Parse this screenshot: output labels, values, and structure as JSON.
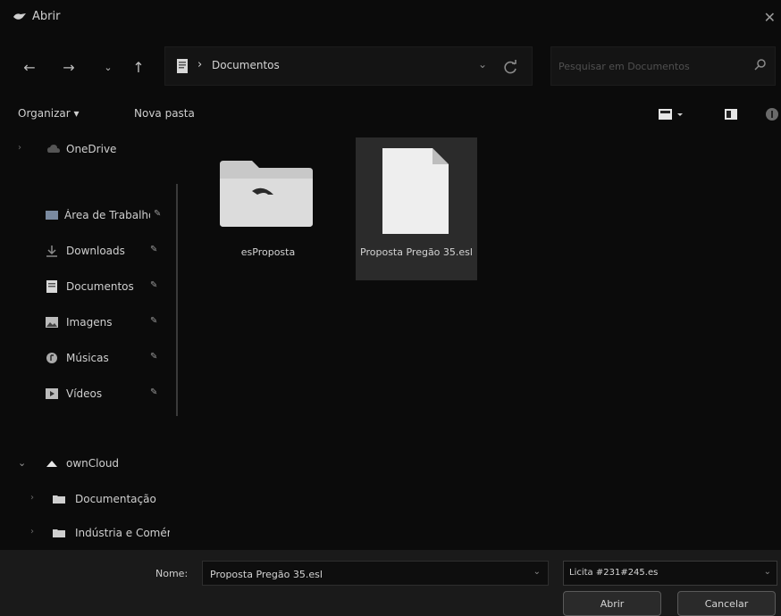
{
  "window": {
    "title": "Abrir"
  },
  "address": {
    "path": "Documentos",
    "separator": "›"
  },
  "search": {
    "placeholder": "Pesquisar em Documentos"
  },
  "commands": {
    "organize": "Organizar ▾",
    "new_folder": "Nova pasta"
  },
  "sidebar": {
    "items": [
      {
        "label": "OneDrive"
      },
      {
        "label": "Área de Trabalho"
      },
      {
        "label": "Downloads"
      },
      {
        "label": "Documentos"
      },
      {
        "label": "Imagens"
      },
      {
        "label": "Músicas"
      },
      {
        "label": "Vídeos"
      },
      {
        "label": "ownCloud"
      },
      {
        "label": "Documentação"
      },
      {
        "label": "Indústria e Comércio"
      }
    ]
  },
  "files": [
    {
      "name": "esProposta",
      "type": "folder"
    },
    {
      "name": "Proposta Pregão 35.esl",
      "type": "file",
      "selected": true
    }
  ],
  "bottom": {
    "name_label": "Nome:",
    "file_name": "Proposta Pregão 35.esl",
    "file_type": "Licita #231#245.es",
    "open_button": "Abrir",
    "cancel_button": "Cancelar"
  }
}
